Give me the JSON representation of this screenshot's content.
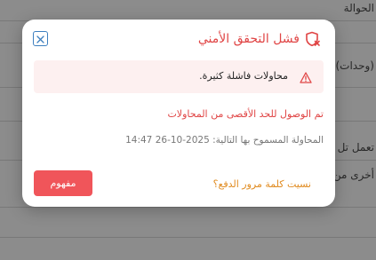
{
  "background": {
    "rows": [
      {
        "text": "الحوالة"
      },
      {
        "text": "(وحدات)"
      },
      {
        "text": "تعمل تل"
      },
      {
        "text": "أخرى من"
      }
    ]
  },
  "modal": {
    "title": "فشل التحقق الأمني",
    "alert_text": "محاولات فاشلة كثيرة.",
    "max_attempts_text": "تم الوصول للحد الأقصى من المحاولات",
    "allowed_attempt_text": "المحاولة المسموح بها التالية: 2025-10-26 14:47",
    "forgot_password_link": "نسيت كلمة مرور الدفع؟",
    "ok_button_label": "مفهوم",
    "icons": {
      "title_icon": "shield-x-icon",
      "alert_icon": "warning-triangle-icon",
      "close_icon": "close-icon"
    },
    "colors": {
      "title": "#e04545",
      "ok_button_bg": "#f0555a",
      "link": "#e08a1e",
      "alert_bg": "#fdf0f0",
      "close_border": "#3d7fbf"
    }
  }
}
